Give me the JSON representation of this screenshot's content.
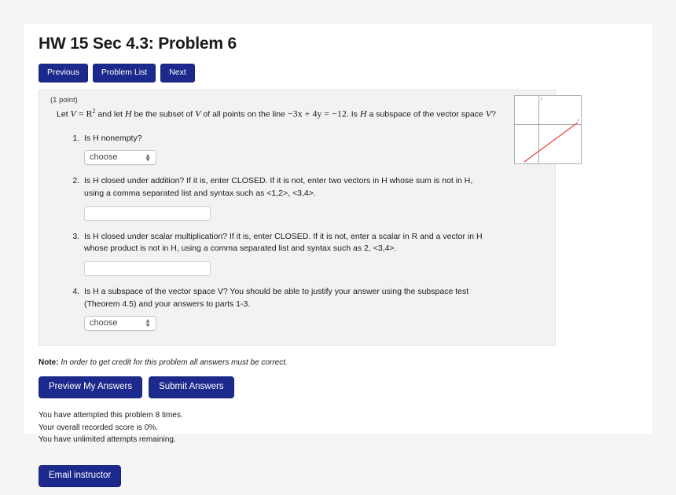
{
  "page": {
    "title": "HW 15 Sec 4.3: Problem 6"
  },
  "nav": {
    "previous": "Previous",
    "problem_list": "Problem List",
    "next": "Next"
  },
  "problem": {
    "points_label": "(1 point)",
    "stem": {
      "let": "Let",
      "v": "V",
      "equals": "=",
      "rr": "R",
      "exponent": "2",
      "and_let": "and let",
      "h": "H",
      "be_subset": "be the subset of",
      "v2": "V",
      "of_all_points": "of all points on the line",
      "equation": "−3x + 4y = −12",
      "period": ".",
      "is": "Is",
      "h2": "H",
      "a_subspace": "a subspace of the vector space",
      "v3": "V",
      "question": "?"
    },
    "parts": [
      {
        "text_before": "Is",
        "full_text": "Is H nonempty?",
        "control": "select",
        "value": "choose"
      },
      {
        "full_text": "Is H closed under addition? If it is, enter CLOSED. If it is not, enter two vectors in H whose sum is not in H, using a comma separated list and syntax such as <1,2>, <3,4>.",
        "control": "text",
        "value": ""
      },
      {
        "full_text": "Is H closed under scalar multiplication? If it is, enter CLOSED. If it is not, enter a scalar in R and a vector in H whose product is not in H, using a comma separated list and syntax such as 2, <3,4>.",
        "control": "text",
        "value": ""
      },
      {
        "full_text": "Is H a subspace of the vector space V? You should be able to justify your answer using the subspace test (Theorem 4.5) and your answers to parts 1-3.",
        "control": "select",
        "value": "choose"
      }
    ],
    "graph": {
      "x_axis_label": "x",
      "y_axis_label": "y",
      "line_color": "#e8413a",
      "axis_color": "#a8a8a8"
    }
  },
  "note": {
    "label": "Note:",
    "text": "In order to get credit for this problem all answers must be correct."
  },
  "actions": {
    "preview": "Preview My Answers",
    "submit": "Submit Answers",
    "email": "Email instructor"
  },
  "status": {
    "attempts": "You have attempted this problem 8 times.",
    "score": "Your overall recorded score is 0%.",
    "remaining": "You have unlimited attempts remaining."
  },
  "colors": {
    "button_blue": "#1b2a8c",
    "panel_bg": "#f2f2f2",
    "page_bg": "#f5f5f5"
  }
}
